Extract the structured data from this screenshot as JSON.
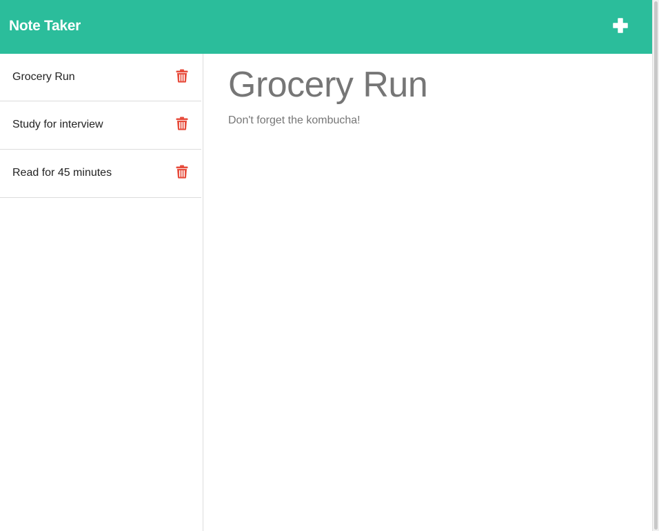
{
  "app": {
    "title": "Note Taker"
  },
  "toolbar": {
    "new_note_icon": "plus-icon"
  },
  "notes": [
    {
      "title": "Grocery Run",
      "delete_icon": "trash-icon"
    },
    {
      "title": "Study for interview",
      "delete_icon": "trash-icon"
    },
    {
      "title": "Read for 45 minutes",
      "delete_icon": "trash-icon"
    }
  ],
  "active_note": {
    "title": "Grocery Run",
    "text": "Don't forget the kombucha!"
  },
  "colors": {
    "header": "#2bbd9b",
    "delete_icon": "#e74c3c",
    "note_text": "#767676"
  }
}
